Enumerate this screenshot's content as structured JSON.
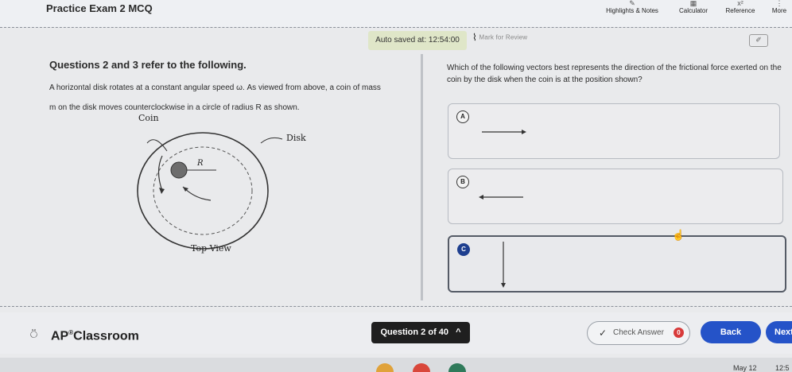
{
  "header": {
    "title": "Practice Exam 2 MCQ",
    "tools": [
      {
        "label": "Highlights & Notes",
        "icon": "highlighter-icon"
      },
      {
        "label": "Calculator",
        "icon": "calculator-icon"
      },
      {
        "label": "Reference",
        "icon": "reference-icon"
      },
      {
        "label": "More",
        "icon": "more-icon"
      }
    ]
  },
  "autosave": {
    "label": "Auto saved at:",
    "time": "12:54:00"
  },
  "mark_review": {
    "label": "Mark for Review"
  },
  "stimulus": {
    "heading": "Questions 2 and 3 refer to the following.",
    "text": "A horizontal disk rotates at a constant angular speed ω. As viewed from above, a coin of mass m on the disk moves counterclockwise in a circle of radius R as shown.",
    "figure": {
      "coin_label": "Coin",
      "disk_label": "Disk",
      "radius_label": "R",
      "caption": "Top View"
    }
  },
  "question": {
    "prompt": "Which of the following vectors best represents the direction of the frictional force exerted on the coin by the disk when the coin is at the position shown?",
    "choices": [
      {
        "letter": "A",
        "direction": "right",
        "selected": false
      },
      {
        "letter": "B",
        "direction": "left",
        "selected": false
      },
      {
        "letter": "C",
        "direction": "down",
        "selected": true
      }
    ]
  },
  "footer": {
    "brand": "AP",
    "brand_suffix": "Classroom",
    "question_nav": "Question 2 of 40",
    "check_answer": "Check Answer",
    "check_count": "0",
    "back": "Back",
    "next": "Next"
  },
  "taskbar": {
    "date": "May 12",
    "time": "12:5"
  }
}
